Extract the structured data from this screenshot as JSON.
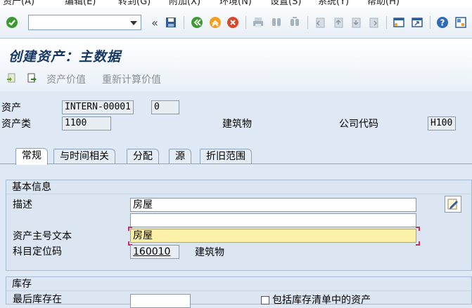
{
  "menu": {
    "items": [
      "资产(A)",
      "编辑(E)",
      "转到(G)",
      "附加(X)",
      "环境(N)",
      "设置(S)",
      "系统(Y)",
      "帮助(H)"
    ]
  },
  "toolbar": {
    "command_value": "",
    "icons": [
      "enter-check-icon",
      "command-dropdown-icon",
      "collapse-icon",
      "save-icon",
      "back-icon",
      "exit-icon",
      "cancel-icon",
      "print-icon",
      "find-icon",
      "find-next-icon",
      "first-page-icon",
      "prev-page-icon",
      "next-page-icon",
      "last-page-icon",
      "new-session-icon",
      "shortcut-icon",
      "help-icon",
      "layout-icon"
    ],
    "collapse_glyph": "«"
  },
  "title": "创建资产：主数据",
  "app_toolbar": {
    "asset_values_label": "资产价值",
    "recalc_values_label": "重新计算价值"
  },
  "header": {
    "asset_label": "资产",
    "asset_number": "INTERN-00001",
    "asset_subnumber": "0",
    "asset_class_label": "资产类",
    "asset_class": "1100",
    "asset_class_desc": "建筑物",
    "company_code_label": "公司代码",
    "company_code": "H100"
  },
  "tabs": [
    {
      "label": "常规",
      "active": true
    },
    {
      "label": "与时间相关",
      "active": false
    },
    {
      "label": "分配",
      "active": false
    },
    {
      "label": "源",
      "active": false
    },
    {
      "label": "折旧范围",
      "active": false
    }
  ],
  "general": {
    "basic_info_title": "基本信息",
    "description_label": "描述",
    "description_value": "房屋",
    "description2_value": "",
    "main_text_label": "资产主号文本",
    "main_text_value": "房屋",
    "account_det_label": "科目定位码",
    "account_det_value": "160010",
    "account_det_desc": "建筑物"
  },
  "inventory": {
    "title": "库存",
    "last_inventory_label": "最后库存在",
    "last_inventory_value": "",
    "include_checkbox_label": "包括库存清单中的资产",
    "include_checked": false
  }
}
